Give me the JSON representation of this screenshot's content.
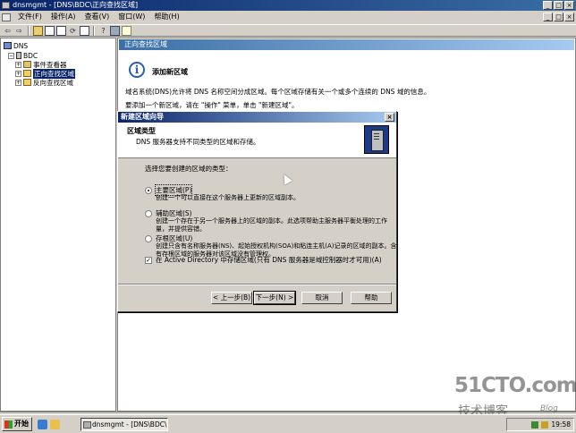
{
  "window": {
    "title": "dnsmgmt - [DNS\\BDC\\正向查找区域]",
    "buttons": [
      "_",
      "□",
      "×"
    ],
    "mdi_buttons": [
      "_",
      "□",
      "×"
    ]
  },
  "menu": {
    "items": [
      "文件(F)",
      "操作(A)",
      "查看(V)",
      "窗口(W)",
      "帮助(H)"
    ]
  },
  "toolbar": {
    "icons": [
      "back-icon",
      "forward-icon",
      "up-folder-icon",
      "show-tree-icon",
      "properties-icon",
      "refresh-icon",
      "export-icon",
      "help-icon",
      "server-icon",
      "new-icon"
    ]
  },
  "tree": {
    "root": "DNS",
    "server": "BDC",
    "items": [
      "事件查看器",
      "正向查找区域",
      "反向查找区域"
    ],
    "selected": "正向查找区域"
  },
  "right_pane": {
    "header": "正向查找区域",
    "info_title": "添加新区域",
    "description": "域名系统(DNS)允许将 DNS 名称空间分成区域。每个区域存储有关一个或多个连续的 DNS 域的信息。",
    "instruction": "要添加一个新区域，请在 \"操作\" 菜单，单击 \"新建区域\"。"
  },
  "dialog": {
    "title": "新建区域向导",
    "close": "×",
    "header_title": "区域类型",
    "header_subtitle": "DNS 服务器支持不同类型的区域和存储。",
    "prompt": "选择您要创建的区域的类型：",
    "options": [
      {
        "label": "主要区域(P)",
        "desc": "创建一个可以直接在这个服务器上更新的区域副本。",
        "checked": true
      },
      {
        "label": "辅助区域(S)",
        "desc": "创建一个存在于另一个服务器上的区域的副本。此选项帮助主服务器平衡处理的工作量，并提供容错。",
        "checked": false
      },
      {
        "label": "存根区域(U)",
        "desc": "创建只含有名称服务器(NS)、起始授权机构(SOA)和粘连主机(A)记录的区域的副本。含有存根区域的服务器对该区域没有管理权。",
        "checked": false
      }
    ],
    "checkbox": {
      "label": "在 Active Directory 中存储区域(只有 DNS 服务器是域控制器时才可用)(A)",
      "checked": true,
      "mark": "✓"
    },
    "buttons": {
      "back": "< 上一步(B)",
      "next": "下一步(N) >",
      "cancel": "取消",
      "help": "帮助"
    }
  },
  "taskbar": {
    "start": "开始",
    "task": "dnsmgmt - [DNS\\BDC\\...",
    "clock": "19:58"
  },
  "watermark": {
    "site": "51CTO.com",
    "blog": "技术博客",
    "blog_en": "Blog"
  }
}
